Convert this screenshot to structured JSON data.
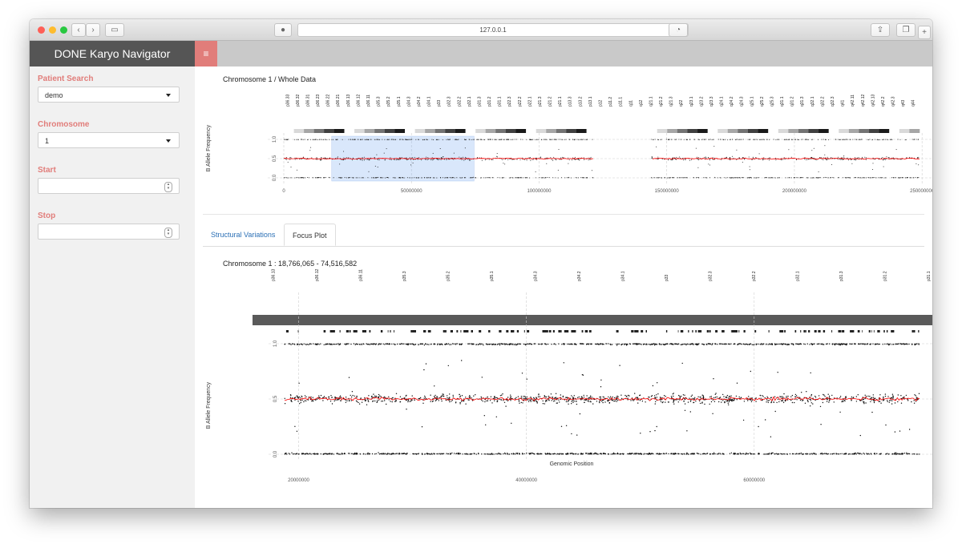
{
  "browser": {
    "url": "127.0.0.1",
    "colors": {
      "close": "#fe5f57",
      "minimize": "#febc2e",
      "maximize": "#28c840"
    }
  },
  "app": {
    "title": "DONE Karyo Navigator",
    "menu_icon": "hamburger-icon",
    "accent_color": "#e17d7a"
  },
  "sidebar": {
    "patient_search": {
      "label": "Patient Search",
      "value": "demo"
    },
    "chromosome": {
      "label": "Chromosome",
      "value": "1"
    },
    "start": {
      "label": "Start",
      "value": ""
    },
    "stop": {
      "label": "Stop",
      "value": ""
    }
  },
  "whole_plot": {
    "title": "Chromosome 1 / Whole Data",
    "ylabel": "B Allele Frequency",
    "yticks": [
      "0.0",
      "0.5",
      "1.0"
    ],
    "xticks": [
      "0",
      "50000000",
      "100000000",
      "150000000",
      "200000000",
      "250000000"
    ],
    "bands": [
      "p36.33",
      "p36.32",
      "p36.31",
      "p36.23",
      "p36.22",
      "p36.21",
      "p36.13",
      "p36.12",
      "p36.11",
      "p35.3",
      "p35.2",
      "p35.1",
      "p34.3",
      "p34.2",
      "p34.1",
      "p33",
      "p32.3",
      "p32.2",
      "p32.1",
      "p31.3",
      "p31.2",
      "p31.1",
      "p22.3",
      "p22.2",
      "p22.1",
      "p21.3",
      "p21.2",
      "p21.1",
      "p13.3",
      "p13.2",
      "p13.1",
      "p12",
      "p11.2",
      "p11.1",
      "q11",
      "q12",
      "q21.1",
      "q21.2",
      "q21.3",
      "q22",
      "q23.1",
      "q23.2",
      "q23.3",
      "q24.1",
      "q24.2",
      "q24.3",
      "q25.1",
      "q25.2",
      "q25.3",
      "q31.1",
      "q31.2",
      "q31.3",
      "q32.1",
      "q32.2",
      "q32.3",
      "q41",
      "q42.11",
      "q42.12",
      "q42.13",
      "q42.2",
      "q42.3",
      "q43",
      "q44"
    ]
  },
  "tabs": [
    {
      "label": "Structural Variations",
      "active": false
    },
    {
      "label": "Focus Plot",
      "active": true
    }
  ],
  "focus_plot": {
    "title": "Chromosome 1 : 18,766,065 - 74,516,582",
    "ylabel": "B Allele Frequency",
    "xlabel": "Genomic Position",
    "yticks": [
      "0.0",
      "0.5",
      "1.0"
    ],
    "xticks": [
      "20000000",
      "40000000",
      "60000000"
    ],
    "bands": [
      "p36.13",
      "p36.12",
      "p36.11",
      "p35.3",
      "p35.2",
      "p35.1",
      "p34.3",
      "p34.2",
      "p34.1",
      "p33",
      "p32.3",
      "p32.2",
      "p32.1",
      "p31.3",
      "p31.2",
      "p31.1"
    ]
  },
  "chart_data": [
    {
      "type": "scatter",
      "title": "Chromosome 1 / Whole Data",
      "xlabel": "",
      "ylabel": "B Allele Frequency",
      "xlim": [
        0,
        249000000
      ],
      "ylim": [
        0,
        1
      ],
      "xticks": [
        0,
        50000000,
        100000000,
        150000000,
        200000000,
        250000000
      ],
      "yticks": [
        0,
        0.5,
        1
      ],
      "selection": [
        18766065,
        74516582
      ],
      "gaps": [
        [
          121500000,
          144000000
        ]
      ],
      "series": [
        {
          "name": "",
          "color": "#000000",
          "bands_y": [
            0,
            0.5,
            1
          ]
        },
        {
          "name": "",
          "color": "#ff0000",
          "y": 0.5
        }
      ],
      "grid": true
    },
    {
      "type": "scatter",
      "title": "Chromosome 1 : 18,766,065 - 74,516,582",
      "xlabel": "Genomic Position",
      "ylabel": "B Allele Frequency",
      "xlim": [
        18766065,
        74516582
      ],
      "ylim": [
        0,
        1
      ],
      "xticks": [
        20000000,
        40000000,
        60000000
      ],
      "yticks": [
        0,
        0.5,
        1
      ],
      "series": [
        {
          "name": "",
          "color": "#000000",
          "bands_y": [
            0,
            0.5,
            1
          ]
        },
        {
          "name": "",
          "color": "#ff0000",
          "y": 0.5
        }
      ],
      "grid": true
    }
  ]
}
